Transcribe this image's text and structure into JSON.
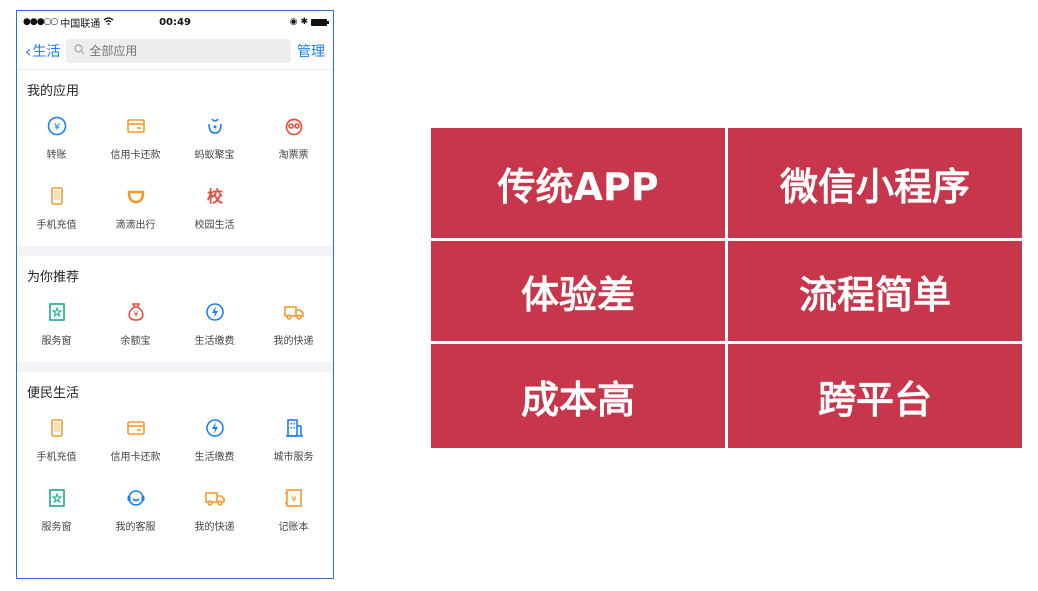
{
  "status": {
    "carrier": "中国联通",
    "time": "00:49"
  },
  "nav": {
    "back_label": "生活",
    "search_placeholder": "全部应用",
    "manage_label": "管理"
  },
  "sections": [
    {
      "title": "我的应用",
      "items": [
        {
          "label": "转账",
          "icon": "transfer-icon",
          "color": "#1a7ff2"
        },
        {
          "label": "信用卡还款",
          "icon": "credit-card-icon",
          "color": "#f39a2b"
        },
        {
          "label": "蚂蚁聚宝",
          "icon": "ant-fortune-icon",
          "color": "#1a7ff2"
        },
        {
          "label": "淘票票",
          "icon": "ticket-icon",
          "color": "#e94b3c"
        },
        {
          "label": "手机充值",
          "icon": "phone-icon",
          "color": "#f39a2b"
        },
        {
          "label": "滴滴出行",
          "icon": "didi-icon",
          "color": "#f39a2b"
        },
        {
          "label": "校园生活",
          "icon": "campus-icon",
          "color": "#e94b3c",
          "glyph": "校"
        }
      ]
    },
    {
      "title": "为你推荐",
      "items": [
        {
          "label": "服务窗",
          "icon": "service-window-icon",
          "color": "#18a89a"
        },
        {
          "label": "余额宝",
          "icon": "money-bag-icon",
          "color": "#e94b3c"
        },
        {
          "label": "生活缴费",
          "icon": "utility-icon",
          "color": "#1a7ff2"
        },
        {
          "label": "我的快递",
          "icon": "delivery-truck-icon",
          "color": "#f39a2b"
        }
      ]
    },
    {
      "title": "便民生活",
      "items": [
        {
          "label": "手机充值",
          "icon": "phone-icon",
          "color": "#f39a2b"
        },
        {
          "label": "信用卡还款",
          "icon": "credit-card-icon",
          "color": "#f39a2b"
        },
        {
          "label": "生活缴费",
          "icon": "utility-icon",
          "color": "#1a7ff2"
        },
        {
          "label": "城市服务",
          "icon": "city-building-icon",
          "color": "#1a7ff2"
        },
        {
          "label": "服务窗",
          "icon": "service-window-icon",
          "color": "#18a89a"
        },
        {
          "label": "我的客服",
          "icon": "customer-service-icon",
          "color": "#1a7ff2"
        },
        {
          "label": "我的快递",
          "icon": "delivery-truck-icon",
          "color": "#f39a2b"
        },
        {
          "label": "记账本",
          "icon": "ledger-icon",
          "color": "#f39a2b"
        }
      ]
    }
  ],
  "comparison": {
    "color": "#c7364a",
    "headers": [
      "传统APP",
      "微信小程序"
    ],
    "rows": [
      [
        "体验差",
        "流程简单"
      ],
      [
        "成本高",
        "跨平台"
      ]
    ]
  }
}
